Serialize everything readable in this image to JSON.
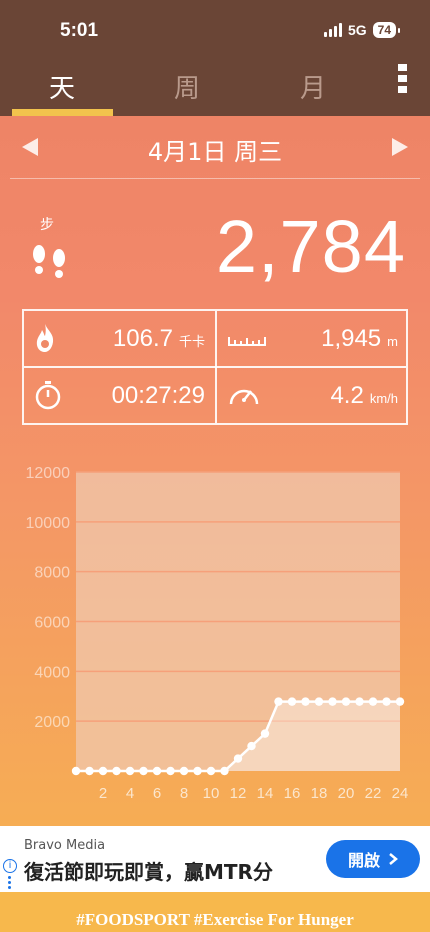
{
  "status_bar": {
    "time": "5:01",
    "network": "5G",
    "battery": "74"
  },
  "tabs": [
    {
      "label": "天",
      "active": true
    },
    {
      "label": "周",
      "active": false
    },
    {
      "label": "月",
      "active": false
    }
  ],
  "date": {
    "label": "4月1日 周三"
  },
  "steps": {
    "label": "步",
    "value": "2,784"
  },
  "stats": {
    "calories": {
      "value": "106.7",
      "unit": "千卡"
    },
    "distance": {
      "value": "1,945",
      "unit": "m"
    },
    "duration": {
      "value": "00:27:29",
      "unit": ""
    },
    "speed": {
      "value": "4.2",
      "unit": "km/h"
    }
  },
  "chart_data": {
    "type": "line",
    "x": [
      0,
      1,
      2,
      3,
      4,
      5,
      6,
      7,
      8,
      9,
      10,
      11,
      12,
      13,
      14,
      15,
      16,
      17,
      18,
      19,
      20,
      21,
      22,
      23,
      24
    ],
    "values": [
      0,
      0,
      0,
      0,
      0,
      0,
      0,
      0,
      0,
      0,
      0,
      0,
      500,
      1000,
      1500,
      2784,
      2784,
      2784,
      2784,
      2784,
      2784,
      2784,
      2784,
      2784,
      2784
    ],
    "x_tick_labels": [
      "2",
      "4",
      "6",
      "8",
      "10",
      "12",
      "14",
      "16",
      "18",
      "20",
      "22",
      "24"
    ],
    "y_tick_labels": [
      "2000",
      "4000",
      "6000",
      "8000",
      "10000",
      "12000"
    ],
    "ylim": [
      0,
      12000
    ],
    "xlim": [
      0,
      24
    ],
    "grid": true,
    "colors": {
      "line": "#ffffff",
      "plot_bg": "#f0c8ae",
      "grid": "#f6a07a"
    }
  },
  "ad": {
    "source": "Bravo Media",
    "text": "復活節即玩即賞，贏MTR分",
    "button_label": "開啟"
  },
  "footer": {
    "text": "#FOODSPORT #Exercise For Hunger"
  }
}
